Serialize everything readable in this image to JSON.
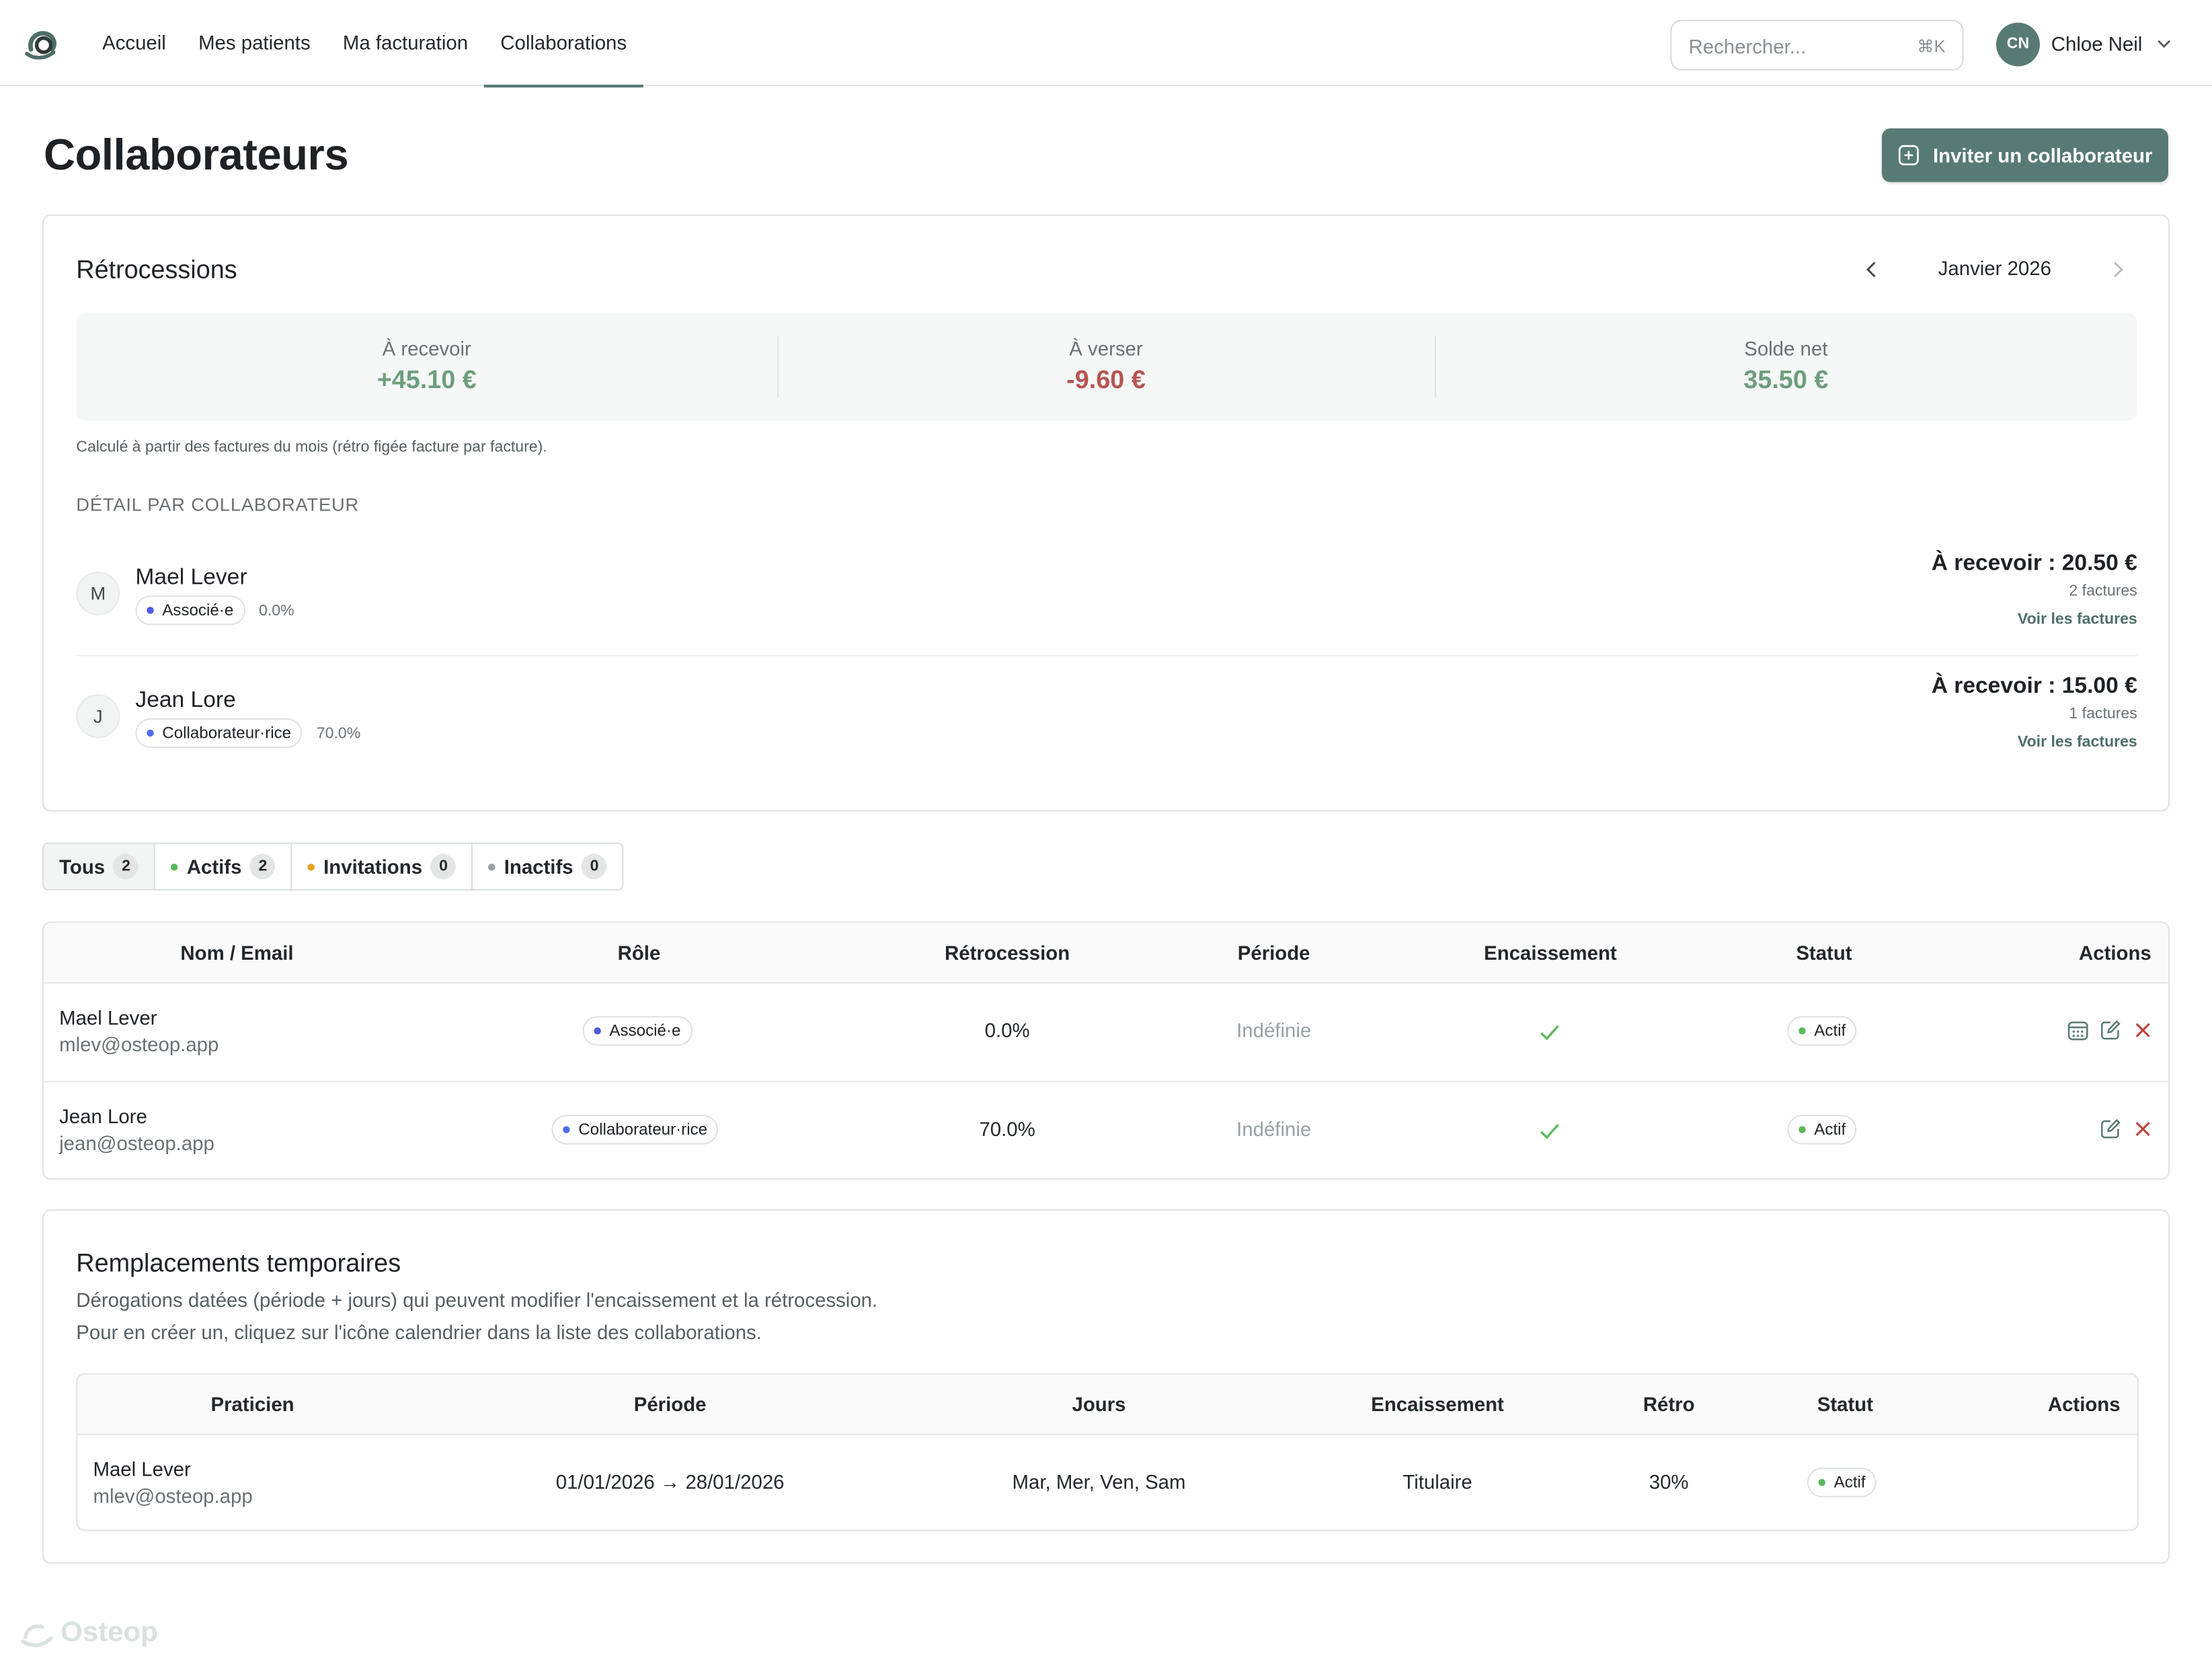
{
  "nav": {
    "items": [
      "Accueil",
      "Mes patients",
      "Ma facturation",
      "Collaborations"
    ],
    "active": "Collaborations"
  },
  "search": {
    "placeholder": "Rechercher...",
    "shortcut": "⌘K"
  },
  "user": {
    "initials": "CN",
    "name": "Chloe Neil"
  },
  "page": {
    "title": "Collaborateurs",
    "invite_label": "Inviter un collaborateur"
  },
  "retro": {
    "title": "Rétrocessions",
    "month": "Janvier 2026",
    "stats": {
      "receive_label": "À recevoir",
      "receive_value": "+45.10 €",
      "pay_label": "À verser",
      "pay_value": "-9.60 €",
      "net_label": "Solde net",
      "net_value": "35.50 €"
    },
    "note": "Calculé à partir des factures du mois (rétro figée facture par facture).",
    "detail_heading": "DÉTAIL PAR COLLABORATEUR",
    "collaborators": [
      {
        "initial": "M",
        "name": "Mael Lever",
        "role": "Associé·e",
        "pct": "0.0%",
        "amount": "À recevoir : 20.50 €",
        "count": "2 factures",
        "link": "Voir les factures"
      },
      {
        "initial": "J",
        "name": "Jean Lore",
        "role": "Collaborateur·rice",
        "pct": "70.0%",
        "amount": "À recevoir : 15.00 €",
        "count": "1 factures",
        "link": "Voir les factures"
      }
    ]
  },
  "filters": [
    {
      "label": "Tous",
      "count": "2"
    },
    {
      "label": "Actifs",
      "count": "2"
    },
    {
      "label": "Invitations",
      "count": "0"
    },
    {
      "label": "Inactifs",
      "count": "0"
    }
  ],
  "table": {
    "headers": [
      "Nom / Email",
      "Rôle",
      "Rétrocession",
      "Période",
      "Encaissement",
      "Statut",
      "Actions"
    ],
    "rows": [
      {
        "name": "Mael Lever",
        "email": "mlev@osteop.app",
        "role": "Associé·e",
        "retro": "0.0%",
        "period": "Indéfinie",
        "status": "Actif"
      },
      {
        "name": "Jean Lore",
        "email": "jean@osteop.app",
        "role": "Collaborateur·rice",
        "retro": "70.0%",
        "period": "Indéfinie",
        "status": "Actif"
      }
    ]
  },
  "replacements": {
    "title": "Remplacements temporaires",
    "sub1": "Dérogations datées (période + jours) qui peuvent modifier l'encaissement et la rétrocession.",
    "sub2": "Pour en créer un, cliquez sur l'icône calendrier dans la liste des collaborations.",
    "headers": [
      "Praticien",
      "Période",
      "Jours",
      "Encaissement",
      "Rétro",
      "Statut",
      "Actions"
    ],
    "rows": [
      {
        "name": "Mael Lever",
        "email": "mlev@osteop.app",
        "period": "01/01/2026 → 28/01/2026",
        "days": "Mar, Mer, Ven, Sam",
        "encaissement": "Titulaire",
        "retro": "30%",
        "status": "Actif"
      }
    ]
  },
  "footer": {
    "brand": "Osteop"
  },
  "colors": {
    "accent": "#587a74",
    "positive": "#6e9e7d",
    "negative": "#b65550"
  }
}
